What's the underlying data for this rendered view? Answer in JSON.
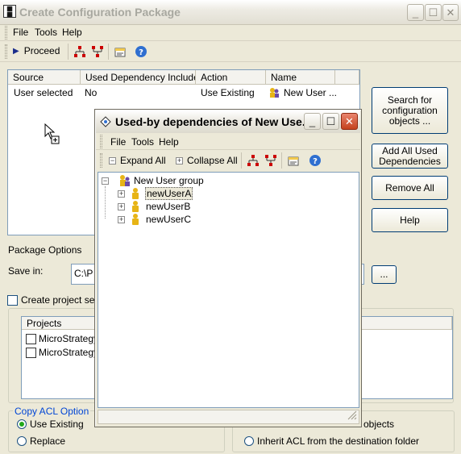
{
  "window": {
    "title": "Create Configuration Package"
  },
  "menu": {
    "file": "File",
    "tools": "Tools",
    "help": "Help"
  },
  "toolbar": {
    "proceed": "Proceed"
  },
  "table": {
    "columns": [
      "Source",
      "Used Dependency Included",
      "Action",
      "Name"
    ],
    "rows": [
      {
        "source": "User selected",
        "dependency": "No",
        "action": "Use Existing",
        "name": "New User ..."
      }
    ]
  },
  "side_buttons": {
    "search": "Search for configuration objects ...",
    "add_all": "Add All Used Dependencies",
    "remove_all": "Remove All",
    "help": "Help"
  },
  "package_options": {
    "label": "Package Options",
    "save_in_label": "Save in:",
    "save_in_value": "C:\\P",
    "browse": "...",
    "create_project_security": "Create project secu",
    "projects_header": "Projects",
    "projects": [
      "MicroStrategy",
      "MicroStrategy"
    ]
  },
  "acl": {
    "legend": "Copy ACL Option",
    "use_existing": "Use Existing",
    "replace": "Replace",
    "objects_suffix": "objects",
    "inherit": "Inherit ACL from the destination folder"
  },
  "dialog": {
    "title": "Used-by dependencies of New Use...",
    "menu": {
      "file": "File",
      "tools": "Tools",
      "help": "Help"
    },
    "toolbar": {
      "expand_all": "Expand All",
      "collapse_all": "Collapse All"
    },
    "tree": {
      "root": "New User group",
      "children": [
        "newUserA",
        "newUserB",
        "newUserC"
      ]
    }
  }
}
